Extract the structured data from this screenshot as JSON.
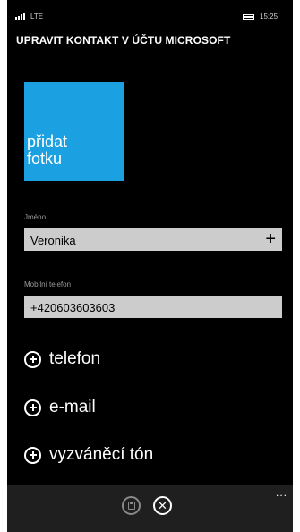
{
  "status_bar": {
    "network": "LTE",
    "time": "15:25",
    "signal_icon": "signal-icon",
    "battery_icon": "battery-icon"
  },
  "header": {
    "title": "UPRAVIT KONTAKT V ÚČTU MICROSOFT"
  },
  "photo_tile": {
    "label": "přidat\nfotku",
    "color": "#1ba1e2"
  },
  "fields": {
    "name": {
      "label": "Jméno",
      "value": "Veronika"
    },
    "mobile": {
      "label": "Mobilní telefon",
      "value": "+420603603603"
    }
  },
  "add_items": [
    {
      "label": "telefon",
      "icon": "add-circle-icon"
    },
    {
      "label": "e-mail",
      "icon": "add-circle-icon"
    },
    {
      "label": "vyzváněcí tón",
      "icon": "add-circle-icon"
    }
  ],
  "app_bar": {
    "save_icon": "save-icon",
    "cancel_icon": "close-icon",
    "more": "..."
  },
  "colors": {
    "accent": "#1ba1e2",
    "background": "#000000",
    "field": "#cccccc"
  }
}
